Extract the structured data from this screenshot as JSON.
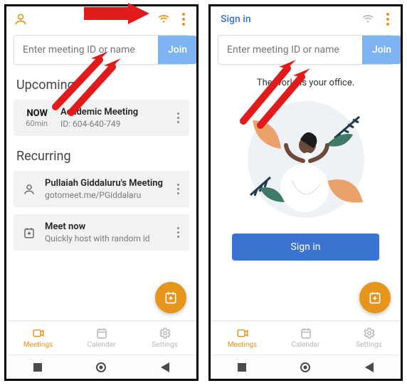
{
  "left": {
    "search_placeholder": "Enter meeting ID or name",
    "join_label": "Join",
    "upcoming_title": "Upcoming",
    "now_label": "NOW",
    "now_duration": "60min",
    "now_meeting_title": "Academic Meeting",
    "now_meeting_id": "ID: 604-640-749",
    "recurring_title": "Recurring",
    "recurring": [
      {
        "title": "Pullaiah Giddaluru's Meeting",
        "sub": "gotomeet.me/PGiddalaru"
      },
      {
        "title": "Meet now",
        "sub": "Quickly host with random id"
      }
    ],
    "tabs": {
      "meetings": "Meetings",
      "calendar": "Calendar",
      "settings": "Settings"
    }
  },
  "right": {
    "signin_link": "Sign in",
    "search_placeholder": "Enter meeting ID or name",
    "join_label": "Join",
    "hero_text": "The world is your office.",
    "signin_button": "Sign in",
    "tabs": {
      "meetings": "Meetings",
      "calendar": "Calendar",
      "settings": "Settings"
    }
  },
  "colors": {
    "accent": "#e5941c",
    "primary": "#3b73d1",
    "annotate": "#e11b1b"
  }
}
